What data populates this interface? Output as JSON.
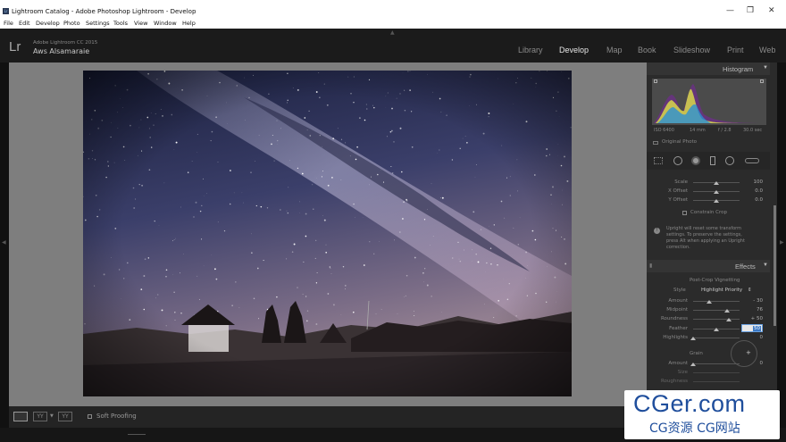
{
  "window": {
    "title": "Lightroom Catalog - Adobe Photoshop Lightroom - Develop",
    "app_icon": "Lr"
  },
  "menu": [
    "File",
    "Edit",
    "Develop",
    "Photo",
    "Settings",
    "Tools",
    "View",
    "Window",
    "Help"
  ],
  "identity": {
    "logo": "Lr",
    "version": "Adobe Lightroom CC 2015",
    "user": "Aws Alsamaraie"
  },
  "modules": [
    {
      "label": "Library",
      "active": false
    },
    {
      "label": "Develop",
      "active": true
    },
    {
      "label": "Map",
      "active": false
    },
    {
      "label": "Book",
      "active": false
    },
    {
      "label": "Slideshow",
      "active": false
    },
    {
      "label": "Print",
      "active": false
    },
    {
      "label": "Web",
      "active": false
    }
  ],
  "histogram": {
    "title": "Histogram",
    "iso": "ISO 6400",
    "focal": "14 mm",
    "aperture": "f / 2.8",
    "shutter": "30.0 sec",
    "original_label": "Original Photo"
  },
  "transform": {
    "scale_label": "Scale",
    "scale_value": "100",
    "xoffset_label": "X Offset",
    "xoffset_value": "0.0",
    "yoffset_label": "Y Offset",
    "yoffset_value": "0.0",
    "constrain_label": "Constrain Crop",
    "upright_note": [
      "Upright will reset some transform",
      "settings. To preserve the settings,",
      "press Alt when applying an Upright",
      "correction."
    ]
  },
  "effects": {
    "title": "Effects",
    "vignette_title": "Post-Crop Vignetting",
    "style_label": "Style",
    "style_value": "Highlight Priority",
    "amount_label": "Amount",
    "amount_value": "- 30",
    "midpoint_label": "Midpoint",
    "midpoint_value": "76",
    "roundness_label": "Roundness",
    "roundness_value": "+ 50",
    "feather_label": "Feather",
    "feather_value": "50",
    "highlights_label": "Highlights",
    "highlights_value": "0",
    "grain_title": "Grain",
    "grain_amount_label": "Amount",
    "grain_amount_value": "0",
    "grain_size_label": "Size",
    "grain_rough_label": "Roughness"
  },
  "toolbar": {
    "soft_proofing": "Soft Proofing"
  },
  "watermark": {
    "main": "CGer.com",
    "sub": "CG资源 CG网站"
  },
  "colors": {
    "accent": "#e6e6e6",
    "panel": "#2b2b2b",
    "workspace": "#7e7e7e",
    "watermark_blue": "#1f4e9c"
  }
}
